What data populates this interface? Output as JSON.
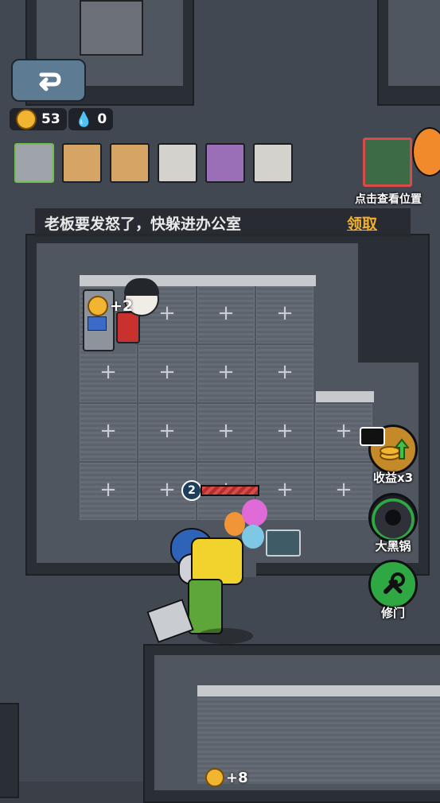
{
  "hud": {
    "coins": "53",
    "water": "0",
    "locate_label": "点击查看位置"
  },
  "banner": {
    "message": "老板要发怒了，快躲进办公室",
    "action_label": "领取"
  },
  "room": {
    "income_popup": "+2",
    "player_level": "2",
    "bottom_income_popup": "+8"
  },
  "side_buttons": [
    {
      "label": "收益x3"
    },
    {
      "label": "大黑锅"
    },
    {
      "label": "修门"
    }
  ],
  "colors": {
    "accent_gold": "#f2b531",
    "link_orange": "#f0b030",
    "green_btn": "#2fa843",
    "danger_red": "#d94a4a"
  }
}
